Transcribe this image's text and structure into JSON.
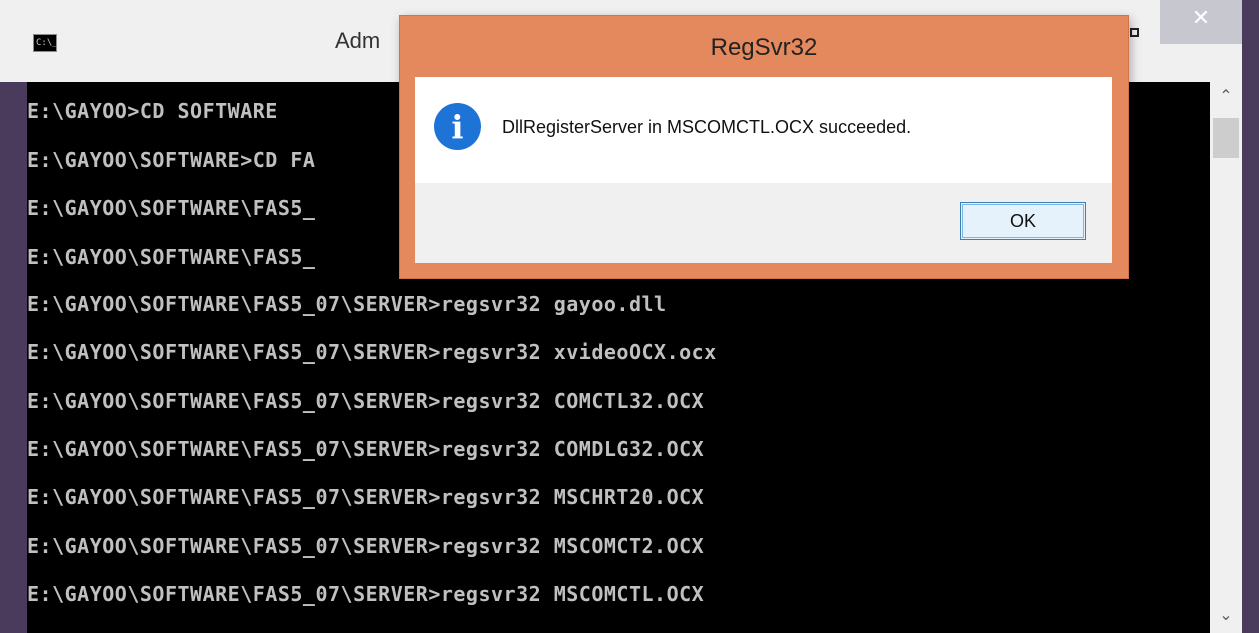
{
  "console": {
    "title": "Adm",
    "icon_text": "C:\\_",
    "lines": [
      "E:\\GAYOO>CD SOFTWARE",
      "E:\\GAYOO\\SOFTWARE>CD FA",
      "E:\\GAYOO\\SOFTWARE\\FAS5_",
      "E:\\GAYOO\\SOFTWARE\\FAS5_",
      "E:\\GAYOO\\SOFTWARE\\FAS5_07\\SERVER>regsvr32 gayoo.dll",
      "E:\\GAYOO\\SOFTWARE\\FAS5_07\\SERVER>regsvr32 xvideoOCX.ocx",
      "E:\\GAYOO\\SOFTWARE\\FAS5_07\\SERVER>regsvr32 COMCTL32.OCX",
      "E:\\GAYOO\\SOFTWARE\\FAS5_07\\SERVER>regsvr32 COMDLG32.OCX",
      "E:\\GAYOO\\SOFTWARE\\FAS5_07\\SERVER>regsvr32 MSCHRT20.OCX",
      "E:\\GAYOO\\SOFTWARE\\FAS5_07\\SERVER>regsvr32 MSCOMCT2.OCX",
      "E:\\GAYOO\\SOFTWARE\\FAS5_07\\SERVER>regsvr32 MSCOMCTL.OCX"
    ],
    "close_glyph": "✕",
    "scroll_up_glyph": "⌃",
    "scroll_down_glyph": "⌄"
  },
  "dialog": {
    "title": "RegSvr32",
    "message": "DllRegisterServer in MSCOMCTL.OCX succeeded.",
    "ok_label": "OK",
    "icon": "info-icon",
    "icon_glyph": "i"
  },
  "colors": {
    "dialog_frame": "#e4895d",
    "window_frame": "#4a3b5c",
    "info_blue": "#1e73d6"
  }
}
